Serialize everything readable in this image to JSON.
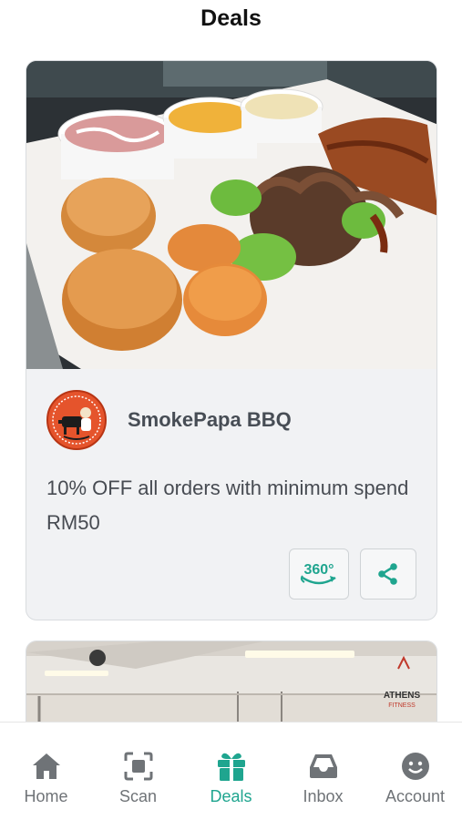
{
  "header": {
    "title": "Deals"
  },
  "deals": [
    {
      "merchant": "SmokePapa BBQ",
      "offer": "10% OFF all orders with minimum spend RM50",
      "photo_icon": "bbq-platter-photo",
      "logo_icon": "smokepapa-logo",
      "buttons": {
        "view360_label": "360°",
        "share_icon": "share-icon"
      }
    },
    {
      "photo_icon": "gym-photo",
      "logo_text": "ATHENS",
      "logo_subtext": "FITNESS"
    }
  ],
  "tabbar": {
    "items": [
      {
        "label": "Home",
        "icon": "home-icon"
      },
      {
        "label": "Scan",
        "icon": "scan-icon"
      },
      {
        "label": "Deals",
        "icon": "gift-icon",
        "active": true
      },
      {
        "label": "Inbox",
        "icon": "inbox-icon"
      },
      {
        "label": "Account",
        "icon": "account-icon"
      }
    ]
  },
  "colors": {
    "accent": "#1fa58f",
    "card_bg": "#f1f2f4",
    "text": "#474b52",
    "inactive": "#6f7377"
  }
}
